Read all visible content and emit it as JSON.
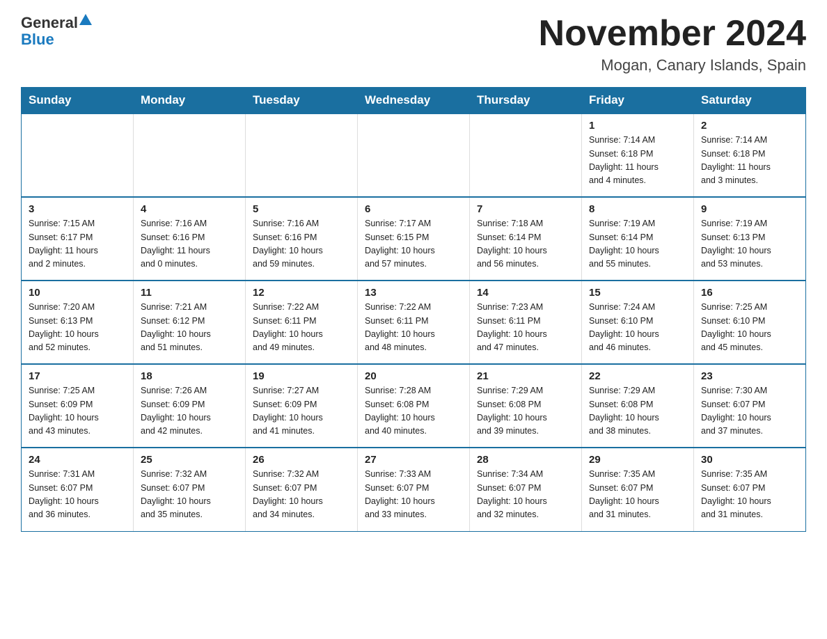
{
  "logo": {
    "general": "General",
    "blue": "Blue"
  },
  "title": "November 2024",
  "subtitle": "Mogan, Canary Islands, Spain",
  "weekdays": [
    "Sunday",
    "Monday",
    "Tuesday",
    "Wednesday",
    "Thursday",
    "Friday",
    "Saturday"
  ],
  "weeks": [
    [
      {
        "day": "",
        "info": ""
      },
      {
        "day": "",
        "info": ""
      },
      {
        "day": "",
        "info": ""
      },
      {
        "day": "",
        "info": ""
      },
      {
        "day": "",
        "info": ""
      },
      {
        "day": "1",
        "info": "Sunrise: 7:14 AM\nSunset: 6:18 PM\nDaylight: 11 hours\nand 4 minutes."
      },
      {
        "day": "2",
        "info": "Sunrise: 7:14 AM\nSunset: 6:18 PM\nDaylight: 11 hours\nand 3 minutes."
      }
    ],
    [
      {
        "day": "3",
        "info": "Sunrise: 7:15 AM\nSunset: 6:17 PM\nDaylight: 11 hours\nand 2 minutes."
      },
      {
        "day": "4",
        "info": "Sunrise: 7:16 AM\nSunset: 6:16 PM\nDaylight: 11 hours\nand 0 minutes."
      },
      {
        "day": "5",
        "info": "Sunrise: 7:16 AM\nSunset: 6:16 PM\nDaylight: 10 hours\nand 59 minutes."
      },
      {
        "day": "6",
        "info": "Sunrise: 7:17 AM\nSunset: 6:15 PM\nDaylight: 10 hours\nand 57 minutes."
      },
      {
        "day": "7",
        "info": "Sunrise: 7:18 AM\nSunset: 6:14 PM\nDaylight: 10 hours\nand 56 minutes."
      },
      {
        "day": "8",
        "info": "Sunrise: 7:19 AM\nSunset: 6:14 PM\nDaylight: 10 hours\nand 55 minutes."
      },
      {
        "day": "9",
        "info": "Sunrise: 7:19 AM\nSunset: 6:13 PM\nDaylight: 10 hours\nand 53 minutes."
      }
    ],
    [
      {
        "day": "10",
        "info": "Sunrise: 7:20 AM\nSunset: 6:13 PM\nDaylight: 10 hours\nand 52 minutes."
      },
      {
        "day": "11",
        "info": "Sunrise: 7:21 AM\nSunset: 6:12 PM\nDaylight: 10 hours\nand 51 minutes."
      },
      {
        "day": "12",
        "info": "Sunrise: 7:22 AM\nSunset: 6:11 PM\nDaylight: 10 hours\nand 49 minutes."
      },
      {
        "day": "13",
        "info": "Sunrise: 7:22 AM\nSunset: 6:11 PM\nDaylight: 10 hours\nand 48 minutes."
      },
      {
        "day": "14",
        "info": "Sunrise: 7:23 AM\nSunset: 6:11 PM\nDaylight: 10 hours\nand 47 minutes."
      },
      {
        "day": "15",
        "info": "Sunrise: 7:24 AM\nSunset: 6:10 PM\nDaylight: 10 hours\nand 46 minutes."
      },
      {
        "day": "16",
        "info": "Sunrise: 7:25 AM\nSunset: 6:10 PM\nDaylight: 10 hours\nand 45 minutes."
      }
    ],
    [
      {
        "day": "17",
        "info": "Sunrise: 7:25 AM\nSunset: 6:09 PM\nDaylight: 10 hours\nand 43 minutes."
      },
      {
        "day": "18",
        "info": "Sunrise: 7:26 AM\nSunset: 6:09 PM\nDaylight: 10 hours\nand 42 minutes."
      },
      {
        "day": "19",
        "info": "Sunrise: 7:27 AM\nSunset: 6:09 PM\nDaylight: 10 hours\nand 41 minutes."
      },
      {
        "day": "20",
        "info": "Sunrise: 7:28 AM\nSunset: 6:08 PM\nDaylight: 10 hours\nand 40 minutes."
      },
      {
        "day": "21",
        "info": "Sunrise: 7:29 AM\nSunset: 6:08 PM\nDaylight: 10 hours\nand 39 minutes."
      },
      {
        "day": "22",
        "info": "Sunrise: 7:29 AM\nSunset: 6:08 PM\nDaylight: 10 hours\nand 38 minutes."
      },
      {
        "day": "23",
        "info": "Sunrise: 7:30 AM\nSunset: 6:07 PM\nDaylight: 10 hours\nand 37 minutes."
      }
    ],
    [
      {
        "day": "24",
        "info": "Sunrise: 7:31 AM\nSunset: 6:07 PM\nDaylight: 10 hours\nand 36 minutes."
      },
      {
        "day": "25",
        "info": "Sunrise: 7:32 AM\nSunset: 6:07 PM\nDaylight: 10 hours\nand 35 minutes."
      },
      {
        "day": "26",
        "info": "Sunrise: 7:32 AM\nSunset: 6:07 PM\nDaylight: 10 hours\nand 34 minutes."
      },
      {
        "day": "27",
        "info": "Sunrise: 7:33 AM\nSunset: 6:07 PM\nDaylight: 10 hours\nand 33 minutes."
      },
      {
        "day": "28",
        "info": "Sunrise: 7:34 AM\nSunset: 6:07 PM\nDaylight: 10 hours\nand 32 minutes."
      },
      {
        "day": "29",
        "info": "Sunrise: 7:35 AM\nSunset: 6:07 PM\nDaylight: 10 hours\nand 31 minutes."
      },
      {
        "day": "30",
        "info": "Sunrise: 7:35 AM\nSunset: 6:07 PM\nDaylight: 10 hours\nand 31 minutes."
      }
    ]
  ]
}
